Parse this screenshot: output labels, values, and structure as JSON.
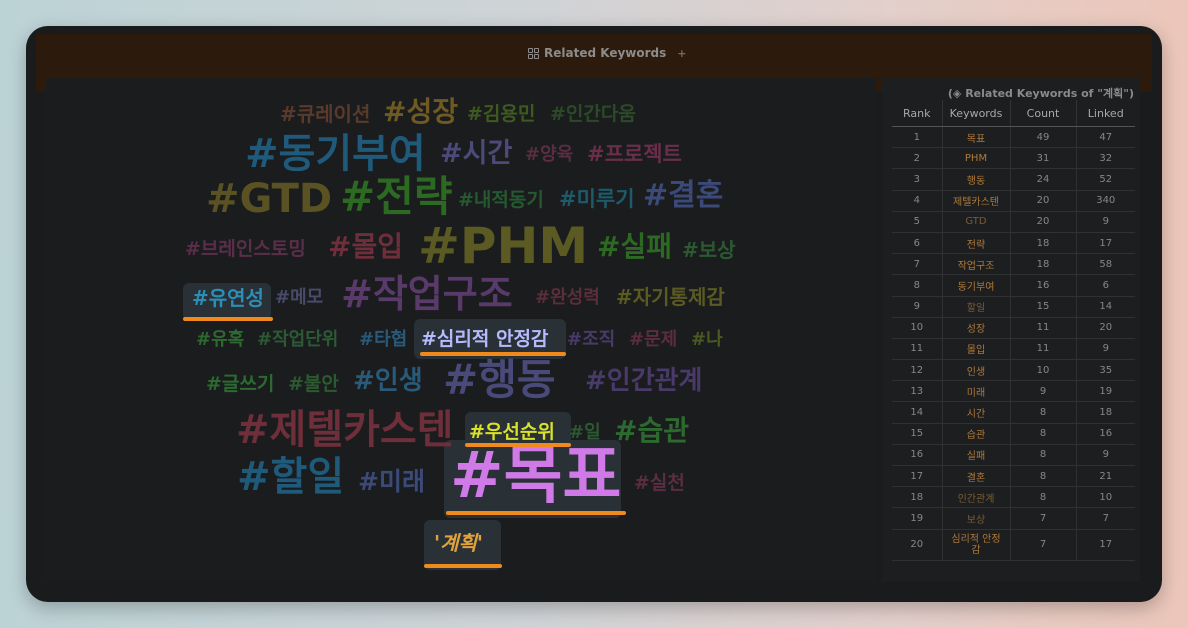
{
  "titlebar": {
    "tab_title": "Related Keywords",
    "tab_add": "+"
  },
  "panel": {
    "caption": "(◈ Related Keywords of \"계획\")",
    "columns": [
      "Rank",
      "Keywords",
      "Count",
      "Linked"
    ],
    "rows": [
      {
        "rank": "1",
        "keyword": "목표",
        "count": "49",
        "linked": "47"
      },
      {
        "rank": "2",
        "keyword": "PHM",
        "count": "31",
        "linked": "32"
      },
      {
        "rank": "3",
        "keyword": "행동",
        "count": "24",
        "linked": "52"
      },
      {
        "rank": "4",
        "keyword": "제텔카스텐",
        "count": "20",
        "linked": "340"
      },
      {
        "rank": "5",
        "keyword": "GTD",
        "count": "20",
        "linked": "9"
      },
      {
        "rank": "6",
        "keyword": "전략",
        "count": "18",
        "linked": "17"
      },
      {
        "rank": "7",
        "keyword": "작업구조",
        "count": "18",
        "linked": "58"
      },
      {
        "rank": "8",
        "keyword": "동기부여",
        "count": "16",
        "linked": "6"
      },
      {
        "rank": "9",
        "keyword": "할일",
        "count": "15",
        "linked": "14"
      },
      {
        "rank": "10",
        "keyword": "성장",
        "count": "11",
        "linked": "20"
      },
      {
        "rank": "11",
        "keyword": "몰입",
        "count": "11",
        "linked": "9"
      },
      {
        "rank": "12",
        "keyword": "인생",
        "count": "10",
        "linked": "35"
      },
      {
        "rank": "13",
        "keyword": "미래",
        "count": "9",
        "linked": "19"
      },
      {
        "rank": "14",
        "keyword": "시간",
        "count": "8",
        "linked": "18"
      },
      {
        "rank": "15",
        "keyword": "습관",
        "count": "8",
        "linked": "16"
      },
      {
        "rank": "16",
        "keyword": "실패",
        "count": "8",
        "linked": "9"
      },
      {
        "rank": "17",
        "keyword": "결혼",
        "count": "8",
        "linked": "21"
      },
      {
        "rank": "18",
        "keyword": "인간관계",
        "count": "8",
        "linked": "10"
      },
      {
        "rank": "19",
        "keyword": "보상",
        "count": "7",
        "linked": "7"
      },
      {
        "rank": "20",
        "keyword": "심리적 안정감",
        "count": "7",
        "linked": "17"
      }
    ]
  },
  "cloud": {
    "center_label": "'계획'",
    "words": [
      {
        "text": "#큐레이션",
        "color": "#5a3a2a"
      },
      {
        "text": "#성장",
        "color": "#6e5a22"
      },
      {
        "text": "#김용민",
        "color": "#3f5a1e"
      },
      {
        "text": "#인간다움",
        "color": "#2d4a28"
      },
      {
        "text": "#동기부여",
        "color": "#1f5a7a"
      },
      {
        "text": "#시간",
        "color": "#4d4a7a"
      },
      {
        "text": "#양육",
        "color": "#5a2e40"
      },
      {
        "text": "#프로젝트",
        "color": "#6a2e4a"
      },
      {
        "text": "#GTD",
        "color": "#5a5222"
      },
      {
        "text": "#전략",
        "color": "#2c6a22"
      },
      {
        "text": "#내적동기",
        "color": "#255a30"
      },
      {
        "text": "#미루기",
        "color": "#1e5a6a"
      },
      {
        "text": "#결혼",
        "color": "#3c4a7a"
      },
      {
        "text": "#브레인스토밍",
        "color": "#5a2e4a"
      },
      {
        "text": "#몰입",
        "color": "#6e2e3a"
      },
      {
        "text": "#PHM",
        "color": "#5a5a22"
      },
      {
        "text": "#실패",
        "color": "#2c6a22"
      },
      {
        "text": "#보상",
        "color": "#2c5a30"
      },
      {
        "text": "#유연성",
        "color": "#2a8fb8"
      },
      {
        "text": "#메모",
        "color": "#4a4a6a"
      },
      {
        "text": "#작업구조",
        "color": "#5a3a6a"
      },
      {
        "text": "#완성력",
        "color": "#5a2e3a"
      },
      {
        "text": "#자기통제감",
        "color": "#5a5a22"
      },
      {
        "text": "#유혹",
        "color": "#2c6a30"
      },
      {
        "text": "#작업단위",
        "color": "#2c5a34"
      },
      {
        "text": "#타협",
        "color": "#2a5a7a"
      },
      {
        "text": "#심리적 안정감",
        "color": "#b5bbff"
      },
      {
        "text": "#조직",
        "color": "#4a3a6a"
      },
      {
        "text": "#문제",
        "color": "#5a2e40"
      },
      {
        "text": "#나",
        "color": "#4a5a22"
      },
      {
        "text": "#글쓰기",
        "color": "#2c6a30"
      },
      {
        "text": "#불안",
        "color": "#2c5a30"
      },
      {
        "text": "#인생",
        "color": "#2a5a7a"
      },
      {
        "text": "#행동",
        "color": "#4a4a7a"
      },
      {
        "text": "#인간관계",
        "color": "#4a3a6a"
      },
      {
        "text": "#제텔카스텐",
        "color": "#6e2e3a"
      },
      {
        "text": "#우선순위",
        "color": "#d8e228"
      },
      {
        "text": "#일",
        "color": "#2c5a30"
      },
      {
        "text": "#습관",
        "color": "#2c6a30"
      },
      {
        "text": "#할일",
        "color": "#1f5a7a"
      },
      {
        "text": "#미래",
        "color": "#3c4a7a"
      },
      {
        "text": "#목표",
        "color": "#d07ae8"
      },
      {
        "text": "#실천",
        "color": "#5a2e40"
      }
    ]
  },
  "colors": {
    "accent_underline": "#f08a1c",
    "center_label": "#e0a23a"
  }
}
